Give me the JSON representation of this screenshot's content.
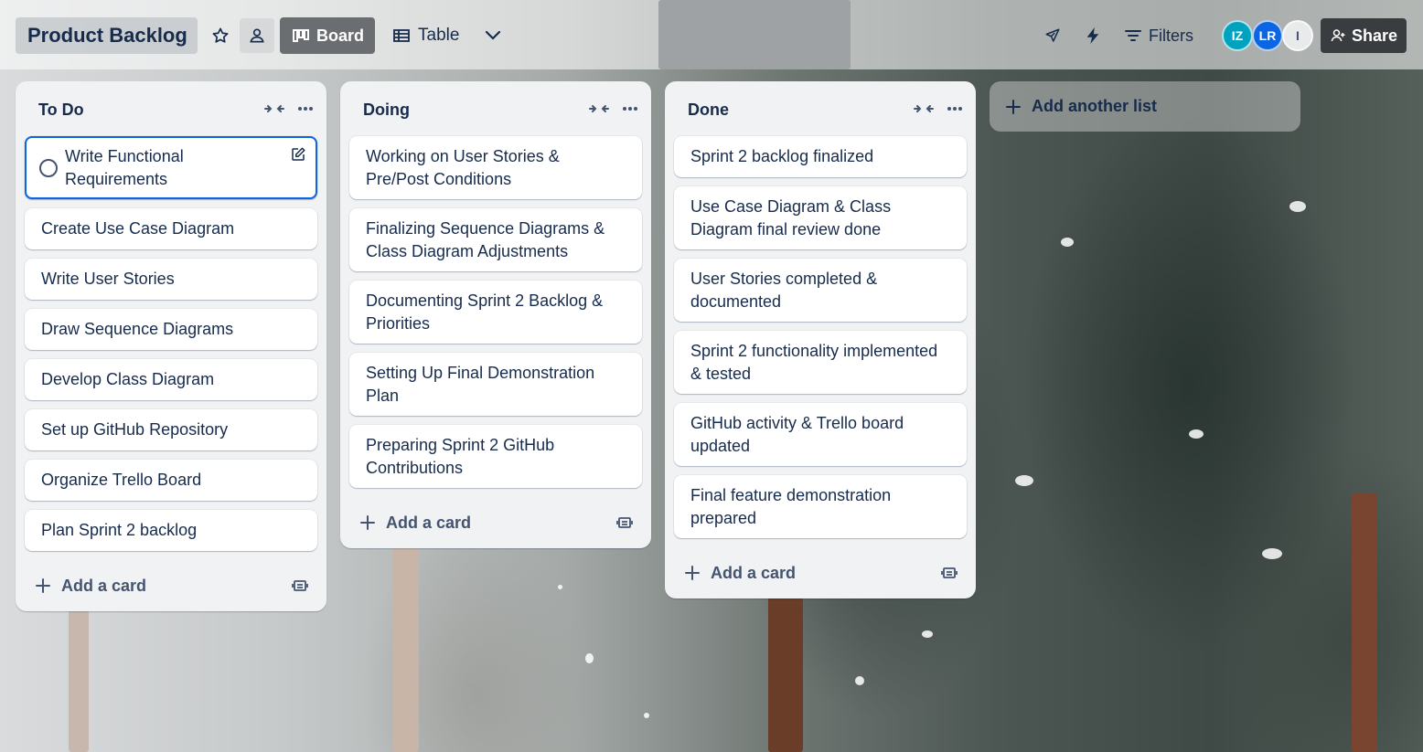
{
  "header": {
    "board_title": "Product Backlog",
    "views": {
      "board": "Board",
      "table": "Table"
    },
    "filters": "Filters",
    "share": "Share",
    "members": [
      {
        "initials": "IZ",
        "color": "#00a3bf"
      },
      {
        "initials": "LR",
        "color": "#0c66e4"
      },
      {
        "initials": "I",
        "color": "#dfe1e6"
      }
    ]
  },
  "lists": [
    {
      "title": "To Do",
      "cards": [
        "Write Functional Requirements",
        "Create Use Case Diagram",
        "Write User Stories",
        "Draw Sequence Diagrams",
        "Develop Class Diagram",
        "Set up GitHub Repository",
        "Organize Trello Board",
        "Plan Sprint 2 backlog"
      ],
      "add_card": "Add a card"
    },
    {
      "title": "Doing",
      "cards": [
        "Working on User Stories & Pre/Post Conditions",
        "Finalizing Sequence Diagrams & Class Diagram Adjustments",
        "Documenting Sprint 2 Backlog & Priorities",
        "Setting Up Final Demonstration Plan",
        "Preparing Sprint 2 GitHub Contributions"
      ],
      "add_card": "Add a card"
    },
    {
      "title": "Done",
      "cards": [
        "Sprint 2 backlog finalized",
        "Use Case Diagram & Class Diagram final review done",
        "User Stories completed & documented",
        "Sprint 2 functionality implemented & tested",
        "GitHub activity & Trello board updated",
        "Final feature demonstration prepared"
      ],
      "add_card": "Add a card"
    }
  ],
  "add_list": "Add another list",
  "colors": {
    "list_bg": "#f1f2f4",
    "focus_border": "#0c66e4",
    "text": "#172b4d"
  }
}
